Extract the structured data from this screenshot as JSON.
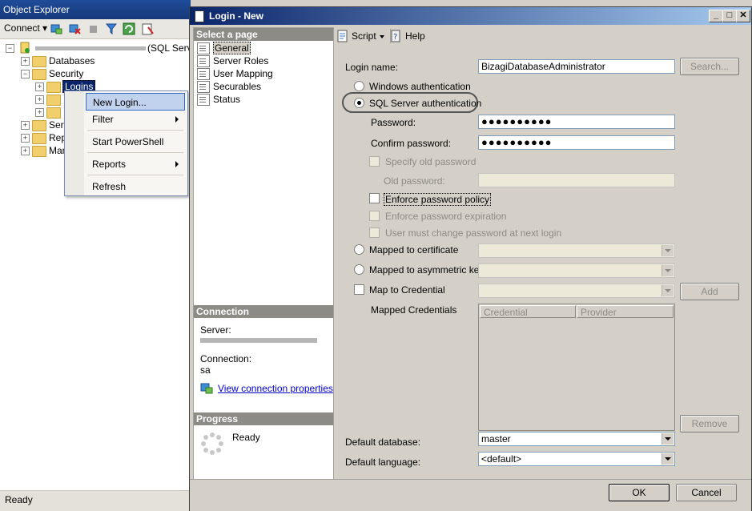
{
  "object_explorer": {
    "title": "Object Explorer",
    "connect_label": "Connect ▾",
    "server_label": "(SQL Serve",
    "tree": {
      "databases": "Databases",
      "security": "Security",
      "logins": "Logins",
      "server_objects": "Serv",
      "replication": "Rep",
      "management": "Man"
    },
    "status": "Ready"
  },
  "context_menu": {
    "items": [
      "New Login...",
      "Filter",
      "Start PowerShell",
      "Reports",
      "Refresh"
    ]
  },
  "dialog": {
    "title": "Login - New",
    "select_page_header": "Select a page",
    "pages": [
      "General",
      "Server Roles",
      "User Mapping",
      "Securables",
      "Status"
    ],
    "connection_header": "Connection",
    "server_label": "Server:",
    "connection_label": "Connection:",
    "connection_value": "sa",
    "view_connection_link": "View connection properties",
    "progress_header": "Progress",
    "progress_status": "Ready",
    "toolbar": {
      "script": "Script",
      "help": "Help"
    },
    "form": {
      "login_name_label": "Login name:",
      "login_name_value": "BizagiDatabaseAdministrator",
      "search_button": "Search...",
      "windows_auth": "Windows authentication",
      "sql_auth": "SQL Server authentication",
      "password_label": "Password:",
      "password_value": "●●●●●●●●●●",
      "confirm_label": "Confirm password:",
      "confirm_value": "●●●●●●●●●●",
      "specify_old": "Specify old password",
      "old_password_label": "Old password:",
      "enforce_policy": "Enforce password policy",
      "enforce_expiration": "Enforce password expiration",
      "must_change": "User must change password at next login",
      "mapped_cert": "Mapped to certificate",
      "mapped_asym": "Mapped to asymmetric key",
      "map_credential": "Map to Credential",
      "add_button": "Add",
      "mapped_credentials_label": "Mapped Credentials",
      "col_credential": "Credential",
      "col_provider": "Provider",
      "remove_button": "Remove",
      "default_db_label": "Default database:",
      "default_db_value": "master",
      "default_lang_label": "Default language:",
      "default_lang_value": "<default>"
    },
    "ok_button": "OK",
    "cancel_button": "Cancel"
  }
}
